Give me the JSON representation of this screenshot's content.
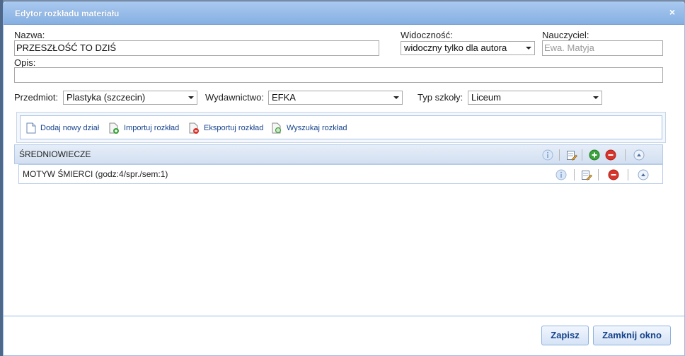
{
  "dialog": {
    "title": "Edytor rozkładu materiału",
    "close_glyph": "×"
  },
  "form": {
    "name_label": "Nazwa:",
    "name_value": "PRZESZŁOŚĆ TO DZIŚ",
    "visibility_label": "Widoczność:",
    "visibility_value": "widoczny tylko dla autora",
    "teacher_label": "Nauczyciel:",
    "teacher_value": "Ewa. Matyja",
    "description_label": "Opis:",
    "description_value": "",
    "subject_label": "Przedmiot:",
    "subject_value": "Plastyka (szczecin)",
    "publisher_label": "Wydawnictwo:",
    "publisher_value": "EFKA",
    "school_type_label": "Typ szkoły:",
    "school_type_value": "Liceum"
  },
  "toolbar": {
    "add_section": "Dodaj nowy dział",
    "import": "Importuj rozkład",
    "export": "Eksportuj rozkład",
    "search": "Wyszukaj rozkład"
  },
  "tree": {
    "section": "ŚREDNIOWIECZE",
    "item": "MOTYW ŚMIERCI (godz:4/spr./sem:1)"
  },
  "footer": {
    "save": "Zapisz",
    "close": "Zamknij okno"
  },
  "colors": {
    "titlebar": "#86b0e2",
    "link": "#15428b",
    "add_green": "#3aa23a",
    "remove_red": "#d9342b"
  }
}
